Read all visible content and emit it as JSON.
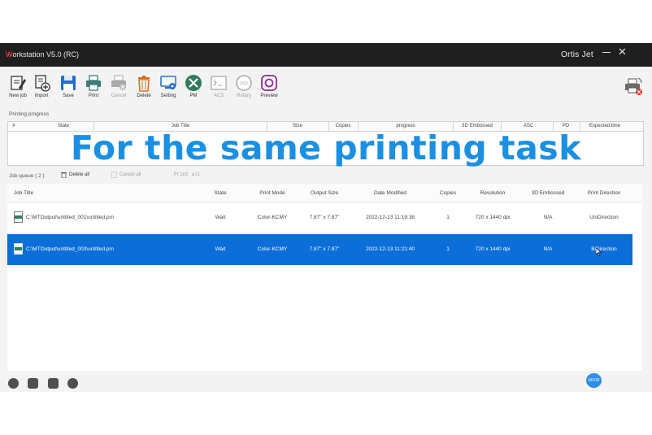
{
  "window": {
    "title": "Workstation V5.0 (RC)",
    "title_first_letter": "W",
    "title_rest": "orkstation V5.0 (RC)",
    "brand": "Ortis Jet",
    "minimize": "minimize",
    "close": "✕"
  },
  "toolbar": [
    {
      "label": "New job",
      "icon": "new-job-icon",
      "enabled": true
    },
    {
      "label": "Import",
      "icon": "import-icon",
      "enabled": true
    },
    {
      "label": "Save",
      "icon": "save-icon",
      "enabled": true
    },
    {
      "label": "Print",
      "icon": "printer-icon",
      "enabled": true
    },
    {
      "label": "Cancel",
      "icon": "cancel-print-icon",
      "enabled": false
    },
    {
      "label": "Delete",
      "icon": "trash-icon",
      "enabled": true
    },
    {
      "label": "Setting",
      "icon": "setting-icon",
      "enabled": true
    },
    {
      "label": "PM",
      "icon": "pm-tools-icon",
      "enabled": true
    },
    {
      "label": "ACS",
      "icon": "terminal-icon",
      "enabled": false
    },
    {
      "label": "Rotary",
      "icon": "rotary-360-icon",
      "enabled": false
    },
    {
      "label": "Preview",
      "icon": "preview-icon",
      "enabled": true
    }
  ],
  "progress": {
    "section_label": "Printing progress",
    "columns": [
      "#",
      "State",
      "Job Title",
      "Size",
      "Copies",
      "progress",
      "3D Embossed",
      "ASC",
      "PD",
      "Expected time"
    ]
  },
  "overlay_caption": "For the same printing task",
  "queue": {
    "label": "Job queue ( 2 )",
    "delete_all": "Delete all",
    "cancel_all": "Cancel all",
    "print_all": "Print all",
    "columns": [
      "Job Title",
      "State",
      "Print Mode",
      "Output Size",
      "Date Modified",
      "Copies",
      "Resolution",
      "3D Embossed",
      "Print Direction"
    ],
    "rows": [
      {
        "title": "C:\\MTOutput\\untitled_001\\untitled.pm",
        "state": "Wait",
        "mode": "Color-KCMY",
        "size": "7.87\" x 7.87\"",
        "date": "2022-12-13 11:19:38",
        "copies": "1",
        "resolution": "720 x 1440 dpi",
        "embossed": "N/A",
        "direction": "UniDirection",
        "selected": false
      },
      {
        "title": "C:\\MTOutput\\untitled_003\\untitled.pm",
        "state": "Wait",
        "mode": "Color-KCMY",
        "size": "7.87\" x 7.87\"",
        "date": "2022-12-13 11:21:40",
        "copies": "1",
        "resolution": "720 x 1440 dpi",
        "embossed": "N/A",
        "direction": "BiDirection",
        "selected": true
      }
    ]
  },
  "status": {
    "time_badge": "00:06"
  },
  "colors": {
    "accent": "#0b6ed9",
    "overlay": "#1a8fe3",
    "titlebar": "#1f1f1f",
    "brand_red": "#e23a2e"
  }
}
